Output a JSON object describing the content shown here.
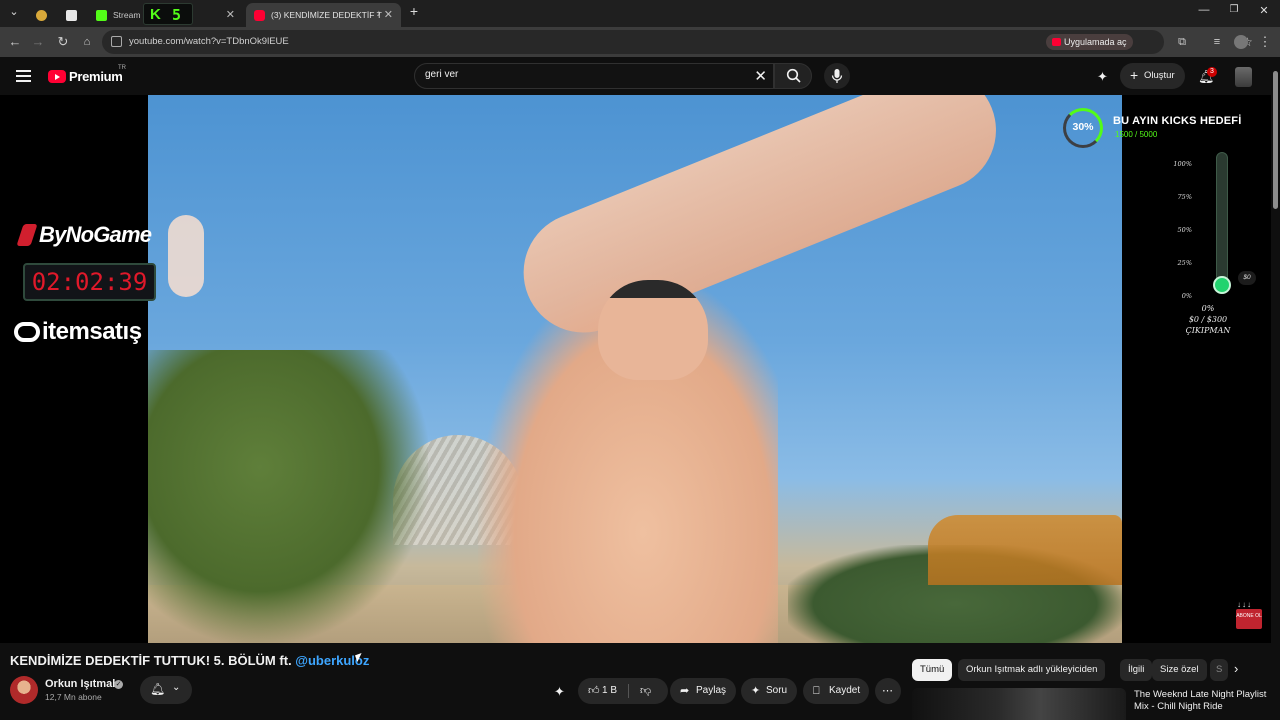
{
  "browser": {
    "tabs": [
      {
        "label": "",
        "active": false
      },
      {
        "label": "",
        "active": false
      },
      {
        "label": "Stream -",
        "active": false
      },
      {
        "label": "(3) KENDİMİZE DEDEKTİF T",
        "active": true
      }
    ],
    "stream_badge": "5",
    "url": "youtube.com/watch?v=TDbnOk9lEUE",
    "open_in_app": "Uygulamada aç"
  },
  "youtube": {
    "logo_text": "Premium",
    "region": "TR",
    "search_value": "geri ver",
    "create_label": "Oluştur",
    "notifications": "3"
  },
  "overlay": {
    "brand": "ByNoGame",
    "timer": "02:02:39",
    "sponsor": "itemsatış",
    "kicks_percent": "30%",
    "kicks_title": "BU AYIN KICKS HEDEFİ",
    "kicks_value": "1500 / 5000",
    "gauge_ticks": [
      "100%",
      "75%",
      "50%",
      "25%",
      "0%"
    ],
    "gauge_amount": "$0",
    "gauge_percent": "0%",
    "gauge_money": "$0 / $300",
    "gauge_label": "ÇIKIPMAN",
    "gauge_level": 0,
    "kicks_progress": 0.3,
    "sub_badge": "ABONE OL"
  },
  "video": {
    "title": "KENDİMİZE DEDEKTİF TUTTUK! 5. BÖLÜM ft.",
    "mention": "@uberkuloz",
    "channel": "Orkun Işıtmak",
    "subscribers": "12,7 Mn abone",
    "likes": "1 B",
    "share": "Paylaş",
    "ask": "Soru",
    "save": "Kaydet"
  },
  "chips": [
    "Tümü",
    "Orkun Işıtmak adlı yükleyiciden",
    "İlgili",
    "Size özel",
    "S"
  ],
  "recommendation": {
    "title": "The Weeknd Late Night Playlist Mix - Chill Night Ride"
  },
  "colors": {
    "accent_red": "#ff0033",
    "kick_green": "#53fc18",
    "link_blue": "#3ea6ff",
    "background": "#0f0f0f"
  }
}
